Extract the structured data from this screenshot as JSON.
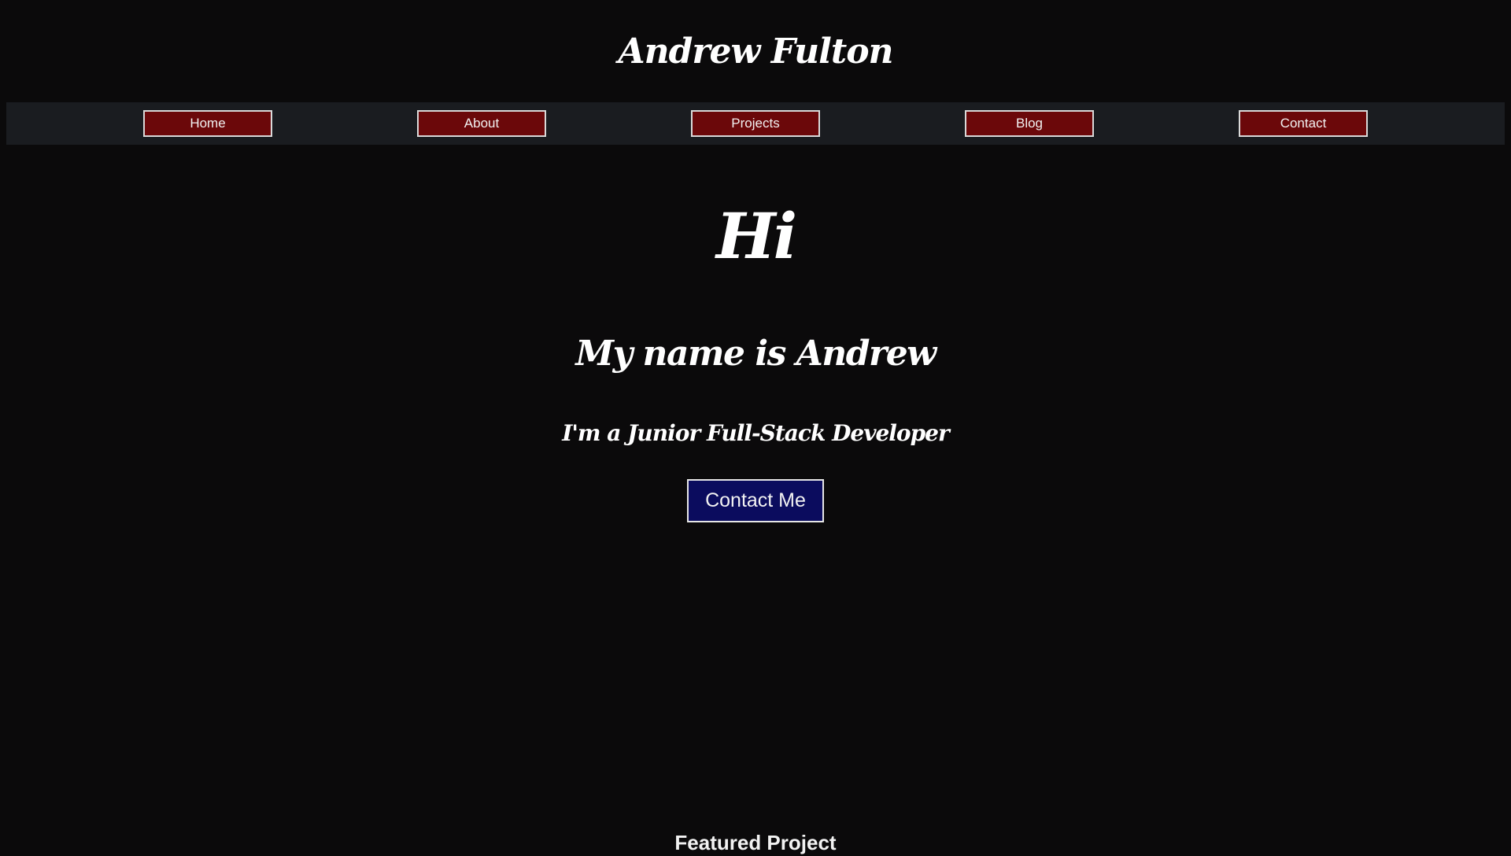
{
  "header": {
    "site_title": "Andrew Fulton"
  },
  "nav": {
    "items": [
      {
        "label": "Home"
      },
      {
        "label": "About"
      },
      {
        "label": "Projects"
      },
      {
        "label": "Blog"
      },
      {
        "label": "Contact"
      }
    ]
  },
  "hero": {
    "greeting": "Hi",
    "name_line": "My name is Andrew",
    "role_line": "I'm a Junior Full-Stack Developer",
    "cta_label": "Contact Me"
  },
  "featured": {
    "heading": "Featured Project"
  },
  "colors": {
    "page_background": "#0b0a0b",
    "nav_background": "#1a1c20",
    "nav_button": "#6b080a",
    "cta_button": "#0b0c5e",
    "text": "#ffffff"
  }
}
